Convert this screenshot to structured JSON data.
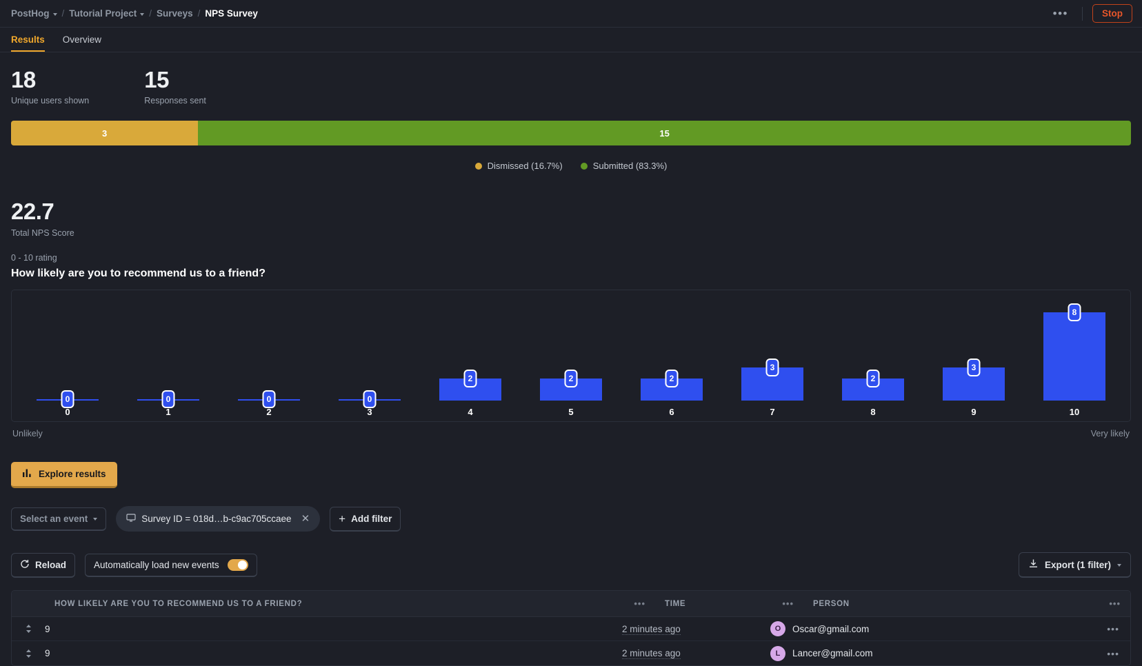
{
  "breadcrumbs": [
    {
      "label": "PostHog",
      "has_chevron": true,
      "active": false
    },
    {
      "label": "Tutorial Project",
      "has_chevron": true,
      "active": false
    },
    {
      "label": "Surveys",
      "has_chevron": false,
      "active": false
    },
    {
      "label": "NPS Survey",
      "has_chevron": false,
      "active": true
    }
  ],
  "topbar": {
    "more_label": "•••",
    "stop_label": "Stop",
    "stop_color": "#e8562a"
  },
  "tabs": [
    {
      "label": "Results",
      "selected": true
    },
    {
      "label": "Overview",
      "selected": false
    }
  ],
  "stats": [
    {
      "value": "18",
      "label": "Unique users shown"
    },
    {
      "value": "15",
      "label": "Responses sent"
    }
  ],
  "progress": {
    "segments": [
      {
        "name": "Dismissed",
        "count": "3",
        "percent": 16.7,
        "color": "#d9a93a"
      },
      {
        "name": "Submitted",
        "count": "15",
        "percent": 83.3,
        "color": "#629a24"
      }
    ],
    "legend": [
      {
        "label": "Dismissed (16.7%)",
        "color": "#d9a93a"
      },
      {
        "label": "Submitted (83.3%)",
        "color": "#629a24"
      }
    ]
  },
  "nps": {
    "score": "22.7",
    "score_label": "Total NPS Score",
    "rating_label": "0 - 10 rating",
    "question": "How likely are you to recommend us to a friend?"
  },
  "chart_data": {
    "type": "bar",
    "title": "How likely are you to recommend us to a friend?",
    "xlabel": "",
    "ylabel": "",
    "categories": [
      "0",
      "1",
      "2",
      "3",
      "4",
      "5",
      "6",
      "7",
      "8",
      "9",
      "10"
    ],
    "values": [
      0,
      0,
      0,
      0,
      2,
      2,
      2,
      3,
      2,
      3,
      8
    ],
    "ylim": [
      0,
      8
    ],
    "grid": false,
    "legend_position": "none",
    "bar_color": "#2f4fef",
    "axis_low_label": "Unlikely",
    "axis_high_label": "Very likely"
  },
  "explore": {
    "label": "Explore results",
    "icon": "bar-chart-icon"
  },
  "filters": {
    "event_select": "Select an event",
    "survey_filter": "Survey ID = 018d…b-c9ac705ccaee",
    "add_filter": "Add filter"
  },
  "toolbar": {
    "reload_label": "Reload",
    "autoload_label": "Automatically load new events",
    "autoload_on": true,
    "export_label": "Export (1 filter)"
  },
  "table": {
    "columns": [
      {
        "label": "HOW LIKELY ARE YOU TO RECOMMEND US TO A FRIEND?",
        "menu": "•••"
      },
      {
        "label": "TIME",
        "menu": "•••"
      },
      {
        "label": "PERSON",
        "menu": "•••"
      }
    ],
    "rows": [
      {
        "answer": "9",
        "time": "2 minutes ago",
        "person": "Oscar@gmail.com",
        "initial": "O"
      },
      {
        "answer": "9",
        "time": "2 minutes ago",
        "person": "Lancer@gmail.com",
        "initial": "L"
      }
    ]
  }
}
